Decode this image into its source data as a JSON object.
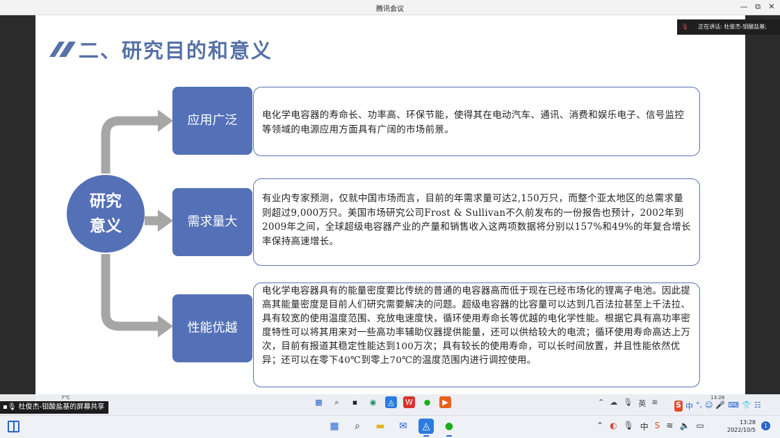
{
  "window": {
    "title": "腾讯会议",
    "controls": [
      "—",
      "⧉",
      "✕"
    ]
  },
  "speaking": {
    "label": "正在讲话: 杜俊杰-钼酸盐基;"
  },
  "slide": {
    "title": "二、研究目的和意义",
    "center_label_line1": "研究",
    "center_label_line2": "意义",
    "items": [
      {
        "label": "应用广泛",
        "text": "电化学电容器的寿命长、功率高、环保节能，使得其在电动汽车、通讯、消费和娱乐电子、信号监控等领域的电源应用方面具有广阔的市场前景。"
      },
      {
        "label": "需求量大",
        "text": "有业内专家预测，仅就中国市场而言，目前的年需求量可达2,150万只，而整个亚太地区的总需求量则超过9,000万只。美国市场研究公司Frost & Sullivan不久前发布的一份报告也预计，2002年到2009年之间，全球超级电容器产业的产量和销售收入这两项数据将分别以157%和49%的年复合增长率保持高速增长。"
      },
      {
        "label": "性能优越",
        "text": "电化学电容器具有的能量密度要比传统的普通的电容器高而低于现在已经市场化的锂离子电池。因此提高其能量密度是目前人们研究需要解决的问题。超级电容器的比容量可以达到几百法拉甚至上千法拉、具有较宽的使用温度范围、充放电速度快，循环使用寿命长等优越的电化学性能。根据它具有高功率密度特性可以将其用来对一些高功率辅助仪器提供能量，还可以供给较大的电流；循环使用寿命高达上万次，目前有报道其稳定性能达到100万次；具有较长的使用寿命，可以长时间放置，并且性能依然优异；还可以在零下40℃到零上70℃的温度范围内进行调控使用。"
      }
    ]
  },
  "inner_taskbar": {
    "weather": "7°C",
    "ime_lang": "英",
    "clock": "13:28",
    "ime_chars": [
      "中",
      "°,",
      "☺",
      "🎤",
      "⌨",
      "👕",
      "☷"
    ]
  },
  "share_label": "杜俊杰-钼酸盐基的屏幕共享",
  "taskbar": {
    "time": "13:28",
    "date": "2022/10/5",
    "tray_ime": "中",
    "notif_count": "1"
  },
  "colors": {
    "accent": "#5471b7",
    "title": "#5671a8",
    "arrow": "#a6a6a6"
  }
}
